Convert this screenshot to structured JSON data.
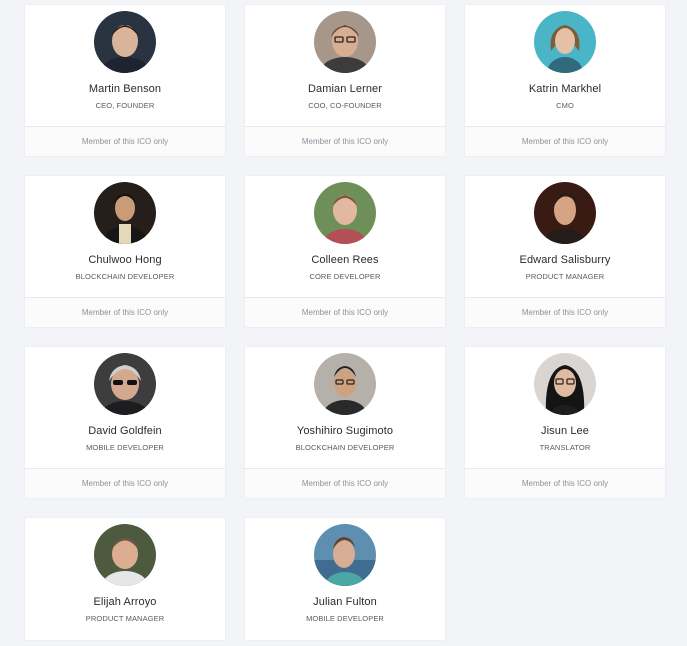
{
  "team": [
    {
      "name": "Martin Benson",
      "role": "CEO, FOUNDER",
      "footer": "Member of this ICO only",
      "avatar_icon": "person-photo",
      "bg": "#2a3440",
      "skin": "#d9b39a",
      "hair": "#2a201a",
      "shirt": "#1d2430"
    },
    {
      "name": "Damian Lerner",
      "role": "COO, CO-FOUNDER",
      "footer": "Member of this ICO only",
      "avatar_icon": "person-photo",
      "bg": "#a6978a",
      "skin": "#d8ad92",
      "hair": "#5b4a3c",
      "shirt": "#3c3c3c"
    },
    {
      "name": "Katrin Markhel",
      "role": "CMO",
      "footer": "Member of this ICO only",
      "avatar_icon": "person-photo",
      "bg": "#49b5c7",
      "skin": "#e4c1a6",
      "hair": "#7d5c3a",
      "shirt": "#2f6b7d"
    },
    {
      "name": "Chulwoo Hong",
      "role": "BLOCKCHAIN DEVELOPER",
      "footer": "Member of this ICO only",
      "avatar_icon": "person-photo",
      "bg": "#251e1a",
      "skin": "#c99c77",
      "hair": "#111111",
      "shirt": "#e3d9b8"
    },
    {
      "name": "Colleen Rees",
      "role": "CORE DEVELOPER",
      "footer": "Member of this ICO only",
      "avatar_icon": "person-photo",
      "bg": "#6f8f58",
      "skin": "#e2b9a0",
      "hair": "#7a5a3e",
      "shirt": "#b54f57"
    },
    {
      "name": "Edward Salisburry",
      "role": "PRODUCT MANAGER",
      "footer": "Member of this ICO only",
      "avatar_icon": "person-photo",
      "bg": "#3a1b14",
      "skin": "#d6a384",
      "hair": "#2b1c14",
      "shirt": "#231c19"
    },
    {
      "name": "David Goldfein",
      "role": "MOBILE DEVELOPER",
      "footer": "Member of this ICO only",
      "avatar_icon": "person-photo",
      "bg": "#3d3c3e",
      "skin": "#d3a88f",
      "hair": "#cfcfcf",
      "shirt": "#1d1d1f"
    },
    {
      "name": "Yoshihiro Sugimoto",
      "role": "BLOCKCHAIN DEVELOPER",
      "footer": "Member of this ICO only",
      "avatar_icon": "person-photo",
      "bg": "#b5b0aa",
      "skin": "#cfa27f",
      "hair": "#232323",
      "shirt": "#292a2c"
    },
    {
      "name": "Jisun Lee",
      "role": "TRANSLATOR",
      "footer": "Member of this ICO only",
      "avatar_icon": "person-photo",
      "bg": "#d8d5d2",
      "skin": "#e1bba1",
      "hair": "#141414",
      "shirt": "#1e1e1e"
    },
    {
      "name": "Elijah Arroyo",
      "role": "PRODUCT MANAGER",
      "footer": "",
      "avatar_icon": "person-photo",
      "bg": "#4d5a3d",
      "skin": "#dcae91",
      "hair": "#6a5747",
      "shirt": "#e6e6e6"
    },
    {
      "name": "Julian Fulton",
      "role": "MOBILE DEVELOPER",
      "footer": "",
      "avatar_icon": "person-photo",
      "bg": "#5f8fb0",
      "skin": "#d7ad93",
      "hair": "#5e4632",
      "shirt": "#4aa7a3"
    }
  ]
}
